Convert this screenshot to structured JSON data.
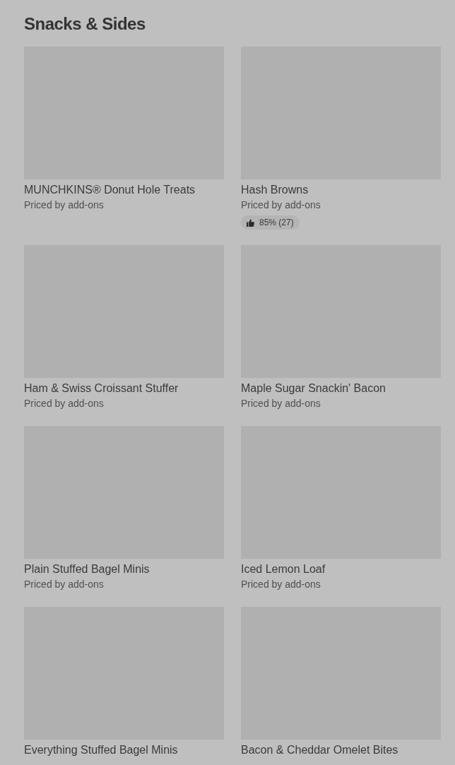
{
  "section": {
    "title": "Snacks & Sides"
  },
  "items": [
    {
      "name": "MUNCHKINS® Donut Hole Treats",
      "price": "Priced by add-ons"
    },
    {
      "name": "Hash Browns",
      "price": "Priced by add-ons",
      "rating": "85% (27)"
    },
    {
      "name": "Ham & Swiss Croissant Stuffer",
      "price": "Priced by add-ons"
    },
    {
      "name": "Maple Sugar Snackin' Bacon",
      "price": "Priced by add-ons"
    },
    {
      "name": "Plain Stuffed Bagel Minis",
      "price": "Priced by add-ons"
    },
    {
      "name": "Iced Lemon Loaf",
      "price": "Priced by add-ons"
    },
    {
      "name": "Everything Stuffed Bagel Minis"
    },
    {
      "name": "Bacon & Cheddar Omelet Bites"
    }
  ]
}
